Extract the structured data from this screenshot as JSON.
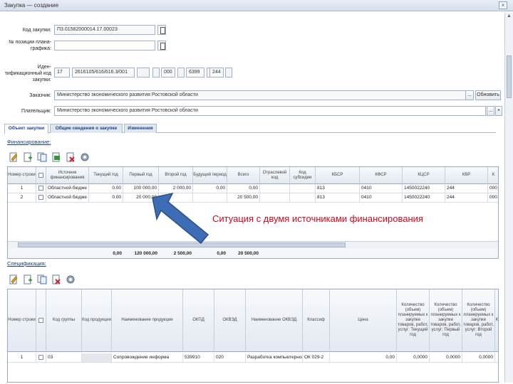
{
  "window": {
    "title": "Закупка — создание",
    "close": "×"
  },
  "form": {
    "purchase_code_label": "Код закупки:",
    "purchase_code_value": "П3.01582000014.17.00023",
    "plan_position_label": "№ позиции плана-графика:",
    "plan_position_value": "",
    "ikz_label": "Иден-тификационный код закупки:",
    "ikz_parts": [
      "17",
      "2616105/616/616.3/001",
      "000",
      "6399",
      "244"
    ],
    "customer_label": "Заказчик:",
    "customer_value": "Министерство экономического развития Ростовской области",
    "customer_btn": "...",
    "customer_update": "Обновить",
    "payer_label": "Плательщик:",
    "payer_value": "Министерство экономического развития Ростовской области",
    "payer_btn": "...",
    "payer_clear": "×"
  },
  "tabs": [
    {
      "label": "Объект закупки"
    },
    {
      "label": "Общие сведения о закупке"
    },
    {
      "label": "Изменения"
    }
  ],
  "financing": {
    "title": "Финансирование:",
    "toolbar": [
      "edit-icon",
      "add-icon",
      "copy-icon",
      "export-icon",
      "delete-icon",
      "settings-icon"
    ],
    "columns": [
      "Номер строки",
      "",
      "Источник финансирования",
      "Текущий год",
      "Первый год",
      "Второй год",
      "Будущий период",
      "Всего",
      "Отраслевой код",
      "Код субсидии",
      "КБСР",
      "КФСР",
      "КЦСР",
      "КВР",
      "К"
    ],
    "rows": [
      [
        "1",
        "",
        "Областной бюдже",
        "0.00",
        "100 000,00",
        "2 000,00",
        "0,00",
        "0,00",
        "",
        "",
        "813",
        "0410",
        "1450022240",
        "244",
        "000"
      ],
      [
        "2",
        "",
        "Областной бюдже",
        "0.00",
        "20 000,00",
        "",
        "",
        "20 500,00",
        "",
        "",
        "813",
        "0410",
        "1450022240",
        "244",
        "000"
      ]
    ],
    "totals": [
      "0,00",
      "120 000,00",
      "2 500,00",
      "0,00",
      "20 500,00"
    ]
  },
  "specification": {
    "title": "Спецификация:",
    "toolbar": [
      "edit-icon",
      "add-icon",
      "copy-icon",
      "delete-icon",
      "settings-icon"
    ],
    "columns": [
      "Номер строки",
      "",
      "Код группы",
      "Код продукции",
      "Наименование продукции",
      "ОКПД",
      "ОКВЭД",
      "Наименование ОКВЭД",
      "Классиф",
      "Цена",
      "",
      "Количество (объем) планируемых к закупке товаров, работ, услуг: Текущий год",
      "Количество (объем) планируемых к закупке товаров, работ, услуг: Первый год",
      "Количество (объем) планируемых к закупке товаров, работ, услуг: Второй год",
      "К"
    ],
    "rows": [
      [
        "1",
        "",
        "03",
        "",
        "Сопровождение информа",
        "539910",
        "020",
        "Разработка компьютерного",
        "ОК 029-2",
        "0,00",
        "",
        "0,0000",
        "0,0000",
        "0,0000",
        ""
      ]
    ]
  },
  "annotation": {
    "text": "Ситуация с двумя источниками финансирования",
    "text_color": "#e0001a",
    "arrow_color": "#3d6db5"
  },
  "colors": {
    "accent": "#15428b",
    "border": "#99a9bf",
    "header_bg": "#e3e9f1"
  }
}
